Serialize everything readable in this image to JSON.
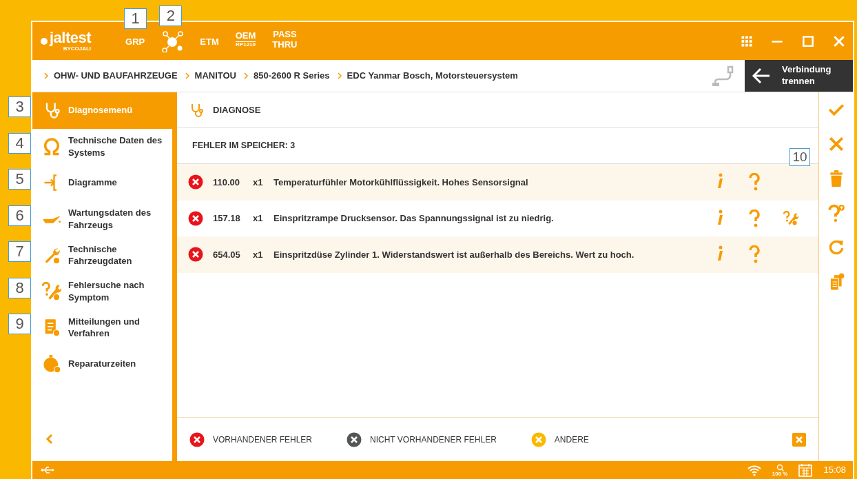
{
  "logo": {
    "name": "jaltest",
    "byline": "BYCOJALI"
  },
  "top_nav": [
    {
      "kind": "text",
      "lines": [
        "GRP"
      ],
      "callout": "1"
    },
    {
      "kind": "network",
      "callout": "2"
    },
    {
      "kind": "text",
      "lines": [
        "ETM"
      ]
    },
    {
      "kind": "oem",
      "lines": [
        "OEM",
        "RP1210"
      ]
    },
    {
      "kind": "text",
      "lines": [
        "PASS",
        "THRU"
      ]
    }
  ],
  "breadcrumb": [
    "OHW- UND BAUFAHRZEUGE",
    "MANITOU",
    "850-2600 R Series",
    "EDC Yanmar Bosch, Motorsteuersystem"
  ],
  "disconnect_button": "Verbindung trennen",
  "sidebar": {
    "items": [
      {
        "label": "Diagnosemenü",
        "selected": true,
        "callout": "3"
      },
      {
        "label": "Technische Daten des Systems",
        "selected": false,
        "callout": "4"
      },
      {
        "label": "Diagramme",
        "selected": false,
        "callout": "5"
      },
      {
        "label": "Wartungsdaten des Fahrzeugs",
        "selected": false,
        "callout": "6"
      },
      {
        "label": "Technische Fahrzeugdaten",
        "selected": false,
        "callout": "7"
      },
      {
        "label": "Fehlersuche nach Symptom",
        "selected": false,
        "callout": "8"
      },
      {
        "label": "Mitteilungen und Verfahren",
        "selected": false,
        "callout": "9"
      },
      {
        "label": "Reparaturzeiten",
        "selected": false
      }
    ]
  },
  "panel_title": "DIAGNOSE",
  "faults_header": "FEHLER IM SPEICHER: 3",
  "faults_callout": "10",
  "faults": [
    {
      "color": "#e8141b",
      "code": "110.00",
      "count": "x1",
      "description": "Temperaturfühler Motorkühlflüssigkeit. Hohes Sensorsignal",
      "symptom_help": false
    },
    {
      "color": "#e8141b",
      "code": "157.18",
      "count": "x1",
      "description": "Einspritzrampe Drucksensor. Das Spannungssignal ist zu niedrig.",
      "symptom_help": true
    },
    {
      "color": "#e8141b",
      "code": "654.05",
      "count": "x1",
      "description": "Einspritzdüse Zylinder 1. Widerstandswert ist außerhalb des Bereichs. Wert zu hoch.",
      "symptom_help": false
    }
  ],
  "legend": [
    {
      "color": "#e8141b",
      "label": "VORHANDENER FEHLER"
    },
    {
      "color": "#555555",
      "label": "NICHT VORHANDENER FEHLER"
    },
    {
      "color": "#fbb800",
      "label": "ANDERE"
    }
  ],
  "status_bar": {
    "zoom": "100 %",
    "time": "15:08"
  }
}
